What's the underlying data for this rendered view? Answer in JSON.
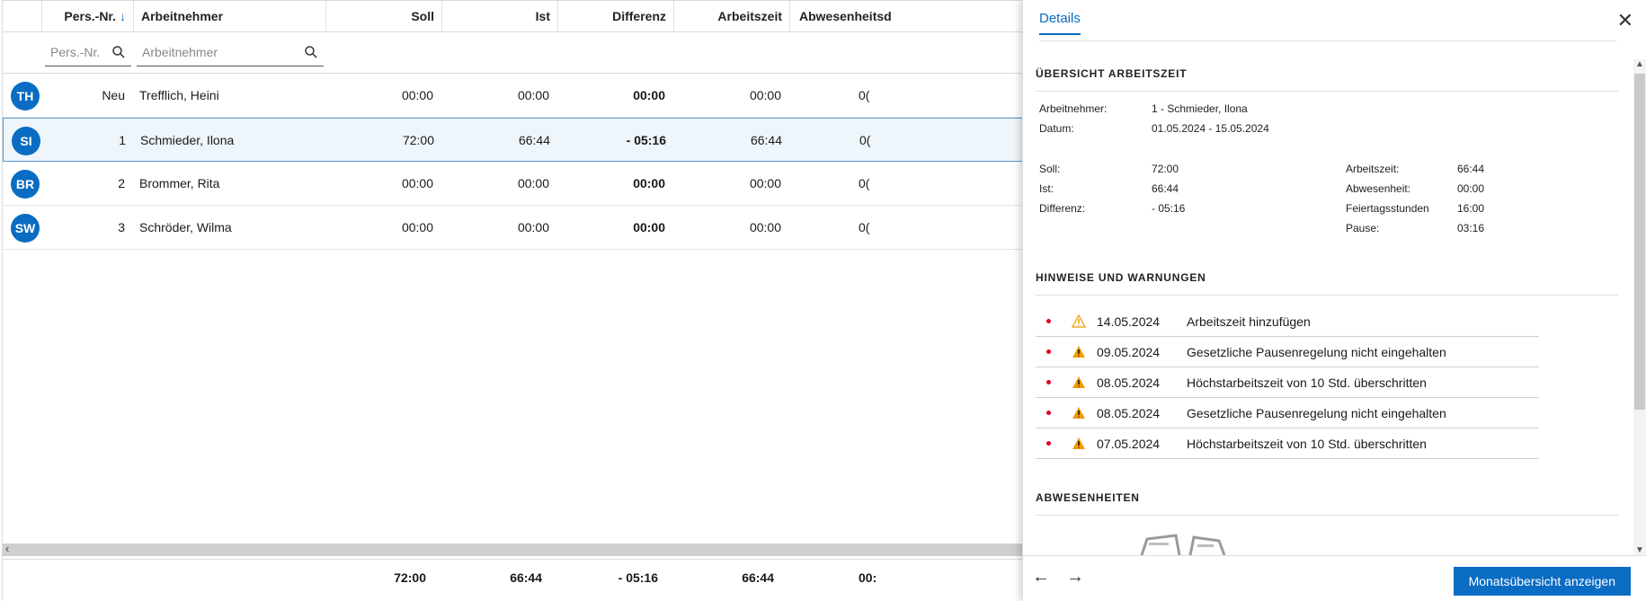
{
  "table": {
    "columns": {
      "persnr": "Pers.-Nr.",
      "sort_icon": "arrow-down",
      "arbeitnehmer": "Arbeitnehmer",
      "soll": "Soll",
      "ist": "Ist",
      "differenz": "Differenz",
      "arbeitszeit": "Arbeitszeit",
      "abwesenheit": "Abwesenheitsd"
    },
    "filters": {
      "persnr_placeholder": "Pers.-Nr.",
      "arbeitnehmer_placeholder": "Arbeitnehmer"
    },
    "rows": [
      {
        "initials": "TH",
        "persnr": "Neu",
        "name": "Trefflich, Heini",
        "soll": "00:00",
        "ist": "00:00",
        "differenz": "00:00",
        "arbeitszeit": "00:00",
        "abwesenheit": "0(",
        "selected": false
      },
      {
        "initials": "SI",
        "persnr": "1",
        "name": "Schmieder, Ilona",
        "soll": "72:00",
        "ist": "66:44",
        "differenz": "- 05:16",
        "arbeitszeit": "66:44",
        "abwesenheit": "0(",
        "selected": true
      },
      {
        "initials": "BR",
        "persnr": "2",
        "name": "Brommer, Rita",
        "soll": "00:00",
        "ist": "00:00",
        "differenz": "00:00",
        "arbeitszeit": "00:00",
        "abwesenheit": "0(",
        "selected": false
      },
      {
        "initials": "SW",
        "persnr": "3",
        "name": "Schröder, Wilma",
        "soll": "00:00",
        "ist": "00:00",
        "differenz": "00:00",
        "arbeitszeit": "00:00",
        "abwesenheit": "0(",
        "selected": false
      }
    ],
    "totals": {
      "soll": "72:00",
      "ist": "66:44",
      "differenz": "- 05:16",
      "arbeitszeit": "66:44",
      "abwesenheit": "00:"
    }
  },
  "panel": {
    "tab": "Details",
    "close_icon": "close-icon",
    "overview": {
      "title": "ÜBERSICHT ARBEITSZEIT",
      "arbeitnehmer_label": "Arbeitnehmer:",
      "arbeitnehmer_value": "1 - Schmieder, Ilona",
      "datum_label": "Datum:",
      "datum_value": "01.05.2024 - 15.05.2024",
      "left": [
        {
          "label": "Soll:",
          "value": "72:00"
        },
        {
          "label": "Ist:",
          "value": "66:44"
        },
        {
          "label": "Differenz:",
          "value": "- 05:16"
        }
      ],
      "right": [
        {
          "label": "Arbeitszeit:",
          "value": "66:44"
        },
        {
          "label": "Abwesenheit:",
          "value": "00:00"
        },
        {
          "label": "Feiertagsstunden",
          "value": "16:00"
        },
        {
          "label": "Pause:",
          "value": "03:16"
        }
      ]
    },
    "warnings": {
      "title": "HINWEISE UND WARNUNGEN",
      "items": [
        {
          "date": "14.05.2024",
          "text": "Arbeitszeit hinzufügen",
          "severity": "hint"
        },
        {
          "date": "09.05.2024",
          "text": "Gesetzliche Pausenregelung nicht eingehalten",
          "severity": "warning"
        },
        {
          "date": "08.05.2024",
          "text": "Höchstarbeitszeit von 10 Std. überschritten",
          "severity": "warning"
        },
        {
          "date": "08.05.2024",
          "text": "Gesetzliche Pausenregelung nicht eingehalten",
          "severity": "warning"
        },
        {
          "date": "07.05.2024",
          "text": "Höchstarbeitszeit von 10 Std. überschritten",
          "severity": "warning"
        }
      ]
    },
    "absences": {
      "title": "ABWESENHEITEN"
    },
    "footer": {
      "prev_icon": "arrow-left-icon",
      "next_icon": "arrow-right-icon",
      "primary_label": "Monatsübersicht anzeigen"
    }
  },
  "colors": {
    "accent": "#0a6cc2",
    "warning": "#f29b00",
    "bullet": "#e2001a",
    "selection": "#eef5fb"
  }
}
